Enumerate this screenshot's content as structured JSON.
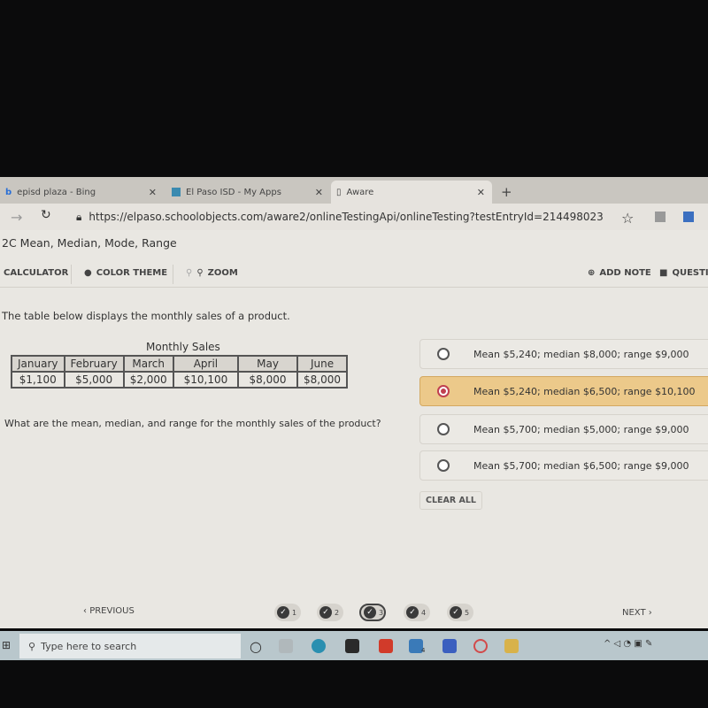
{
  "browser": {
    "tabs": [
      {
        "label": "episd plaza - Bing"
      },
      {
        "label": "El Paso ISD - My Apps"
      },
      {
        "label": "Aware",
        "active": true
      }
    ],
    "url": "https://elpaso.schoolobjects.com/aware2/onlineTestingApi/onlineTesting?testEntryId=214498023"
  },
  "page": {
    "title": "2C Mean, Median, Mode, Range",
    "toolbar": {
      "calculator": "CALCULATOR",
      "color_theme": "COLOR THEME",
      "zoom": "ZOOM",
      "add_note": "ADD NOTE",
      "question": "QUESTI"
    },
    "prompt": "The table below displays the monthly sales of a product.",
    "table": {
      "caption": "Monthly Sales",
      "headers": [
        "January",
        "February",
        "March",
        "April",
        "May",
        "June"
      ],
      "values": [
        "$1,100",
        "$5,000",
        "$2,000",
        "$10,100",
        "$8,000",
        "$8,000"
      ]
    },
    "question": "What are the mean, median, and range for the monthly sales of the product?",
    "options": [
      {
        "label": "Mean $5,240; median $8,000; range $9,000",
        "selected": false
      },
      {
        "label": "Mean $5,240; median $6,500; range $10,100",
        "selected": true
      },
      {
        "label": "Mean $5,700; median $5,000; range $9,000",
        "selected": false
      },
      {
        "label": "Mean $5,700; median $6,500; range $9,000",
        "selected": false
      }
    ],
    "clear_all": "CLEAR ALL",
    "nav": {
      "previous": "PREVIOUS",
      "next": "NEXT",
      "questions": [
        "1",
        "2",
        "3",
        "4",
        "5"
      ],
      "current": "3"
    }
  },
  "taskbar": {
    "search_placeholder": "Type here to search",
    "mail_badge": "4"
  },
  "colors": {
    "selected_option": "#ecc98a",
    "radio_selected": "#c04050"
  }
}
